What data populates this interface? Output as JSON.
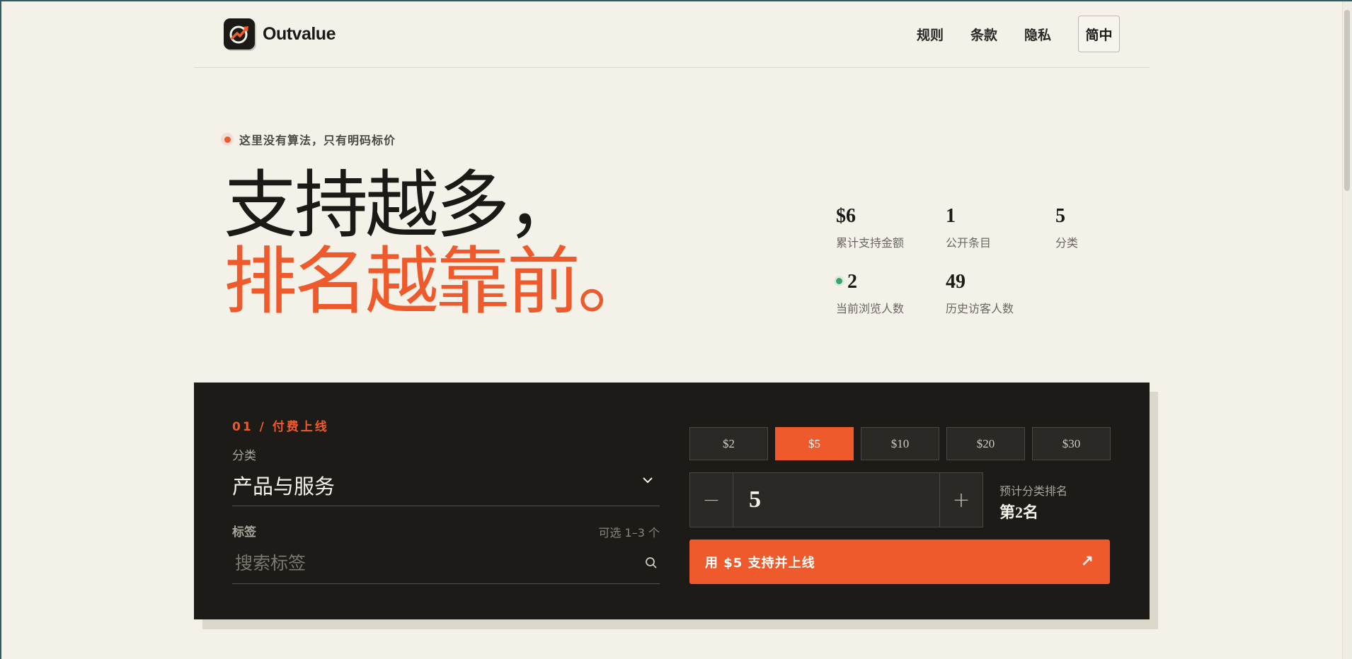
{
  "colors": {
    "background": "#f4f1e9",
    "accent": "#ee5a2b",
    "dark_panel": "#1c1b17",
    "live_green": "#3aa564"
  },
  "header": {
    "brand": "Outvalue",
    "nav": [
      {
        "label": "规则"
      },
      {
        "label": "条款"
      },
      {
        "label": "隐私"
      }
    ],
    "language": "简中"
  },
  "hero": {
    "eyebrow": "这里没有算法，只有明码标价",
    "line1": "支持越多，",
    "line2": "排名越靠前。"
  },
  "stats": {
    "total_amount": {
      "value": "$6",
      "label": "累计支持金额"
    },
    "public_entries": {
      "value": "1",
      "label": "公开条目"
    },
    "categories": {
      "value": "5",
      "label": "分类"
    },
    "current_viewers": {
      "value": "2",
      "label": "当前浏览人数"
    },
    "total_visitors": {
      "value": "49",
      "label": "历史访客人数"
    }
  },
  "form": {
    "step_label": "01 / 付费上线",
    "category_label": "分类",
    "category_value": "产品与服务",
    "tags_label": "标签",
    "tags_hint": "可选 1–3 个",
    "tags_placeholder": "搜索标签",
    "amount_options": [
      "$2",
      "$5",
      "$10",
      "$20",
      "$30"
    ],
    "selected_amount": "$5",
    "stepper_value": "5",
    "minus_label": "−",
    "plus_label": "+",
    "rank_label": "预计分类排名",
    "rank_value": "第2名",
    "cta_label": "用 $5 支持并上线",
    "cta_arrow": "↗"
  }
}
